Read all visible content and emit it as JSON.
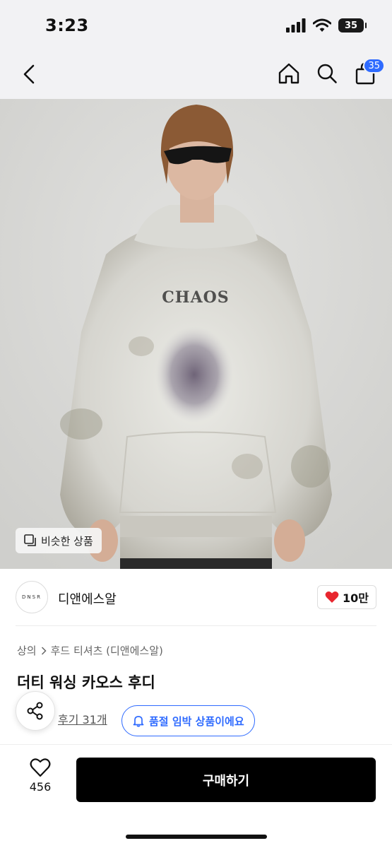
{
  "status": {
    "time": "3:23",
    "battery": "35"
  },
  "nav": {
    "cart_count": "35"
  },
  "hero": {
    "print_text": "CHAOS",
    "similar_label": "비슷한 상품"
  },
  "brand": {
    "logo_text": "DNSR",
    "name": "디앤에스알",
    "likes": "10만"
  },
  "breadcrumb": {
    "category": "상의",
    "subcategory": "후드 티셔츠 (디앤에스알)"
  },
  "product": {
    "title": "더티 워싱 카오스 후디"
  },
  "reviews": {
    "label": "후기 31개"
  },
  "stock": {
    "label": "품절 임박 상품이에요"
  },
  "bottom": {
    "wish_count": "456",
    "buy_label": "구매하기"
  },
  "colors": {
    "accent": "#2f6bff",
    "like_heart": "#e8262e",
    "buy_bg": "#000000"
  }
}
